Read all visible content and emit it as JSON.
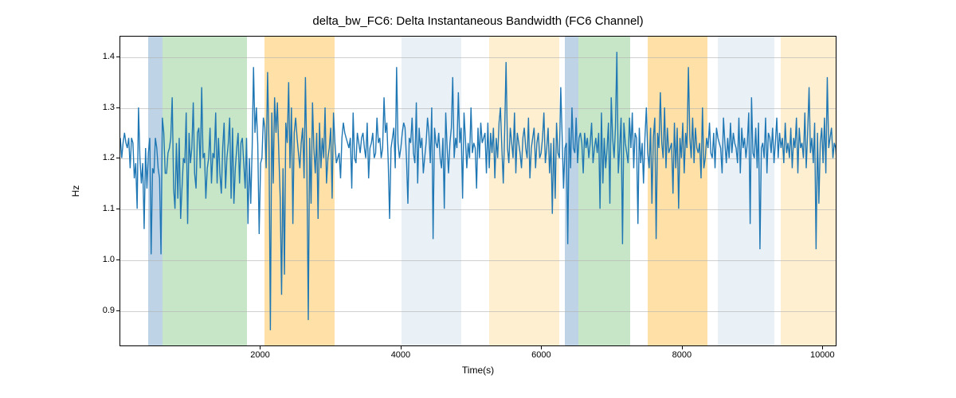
{
  "chart_data": {
    "type": "line",
    "title": "delta_bw_FC6: Delta Instantaneous Bandwidth (FC6 Channel)",
    "xlabel": "Time(s)",
    "ylabel": "Hz",
    "xlim": [
      0,
      10200
    ],
    "ylim": [
      0.83,
      1.44
    ],
    "x_ticks": [
      2000,
      4000,
      6000,
      8000,
      10000
    ],
    "y_ticks": [
      0.9,
      1.0,
      1.1,
      1.2,
      1.3,
      1.4
    ],
    "bands": [
      {
        "x0": 400,
        "x1": 600,
        "color": "blue-dark"
      },
      {
        "x0": 600,
        "x1": 1800,
        "color": "green"
      },
      {
        "x0": 2050,
        "x1": 3050,
        "color": "orange"
      },
      {
        "x0": 4000,
        "x1": 4200,
        "color": "blue-light"
      },
      {
        "x0": 4200,
        "x1": 4850,
        "color": "blue-light"
      },
      {
        "x0": 5250,
        "x1": 6250,
        "color": "orange-light"
      },
      {
        "x0": 6320,
        "x1": 6520,
        "color": "blue-dark"
      },
      {
        "x0": 6520,
        "x1": 7250,
        "color": "green"
      },
      {
        "x0": 7500,
        "x1": 8350,
        "color": "orange"
      },
      {
        "x0": 8500,
        "x1": 9300,
        "color": "blue-light"
      },
      {
        "x0": 9400,
        "x1": 10200,
        "color": "orange-light"
      }
    ],
    "series": [
      {
        "name": "delta_bw_FC6",
        "color": "#1f77b4",
        "x_start": 0,
        "x_step": 20,
        "values": [
          1.24,
          1.2,
          1.23,
          1.25,
          1.23,
          1.22,
          1.24,
          1.18,
          1.24,
          1.23,
          1.16,
          1.19,
          1.1,
          1.3,
          1.2,
          1.15,
          1.19,
          1.06,
          1.22,
          1.14,
          1.21,
          1.24,
          1.01,
          1.18,
          1.17,
          1.24,
          1.22,
          1.18,
          1.16,
          1.01,
          1.28,
          1.25,
          1.17,
          1.17,
          1.21,
          1.22,
          1.24,
          1.32,
          1.14,
          1.1,
          1.23,
          1.12,
          1.24,
          1.08,
          1.14,
          1.2,
          1.19,
          1.29,
          1.07,
          1.25,
          1.19,
          1.22,
          1.31,
          1.17,
          1.14,
          1.25,
          1.26,
          1.18,
          1.34,
          1.2,
          1.21,
          1.12,
          1.18,
          1.2,
          1.26,
          1.15,
          1.21,
          1.2,
          1.29,
          1.15,
          1.24,
          1.17,
          1.13,
          1.22,
          1.27,
          1.14,
          1.2,
          1.23,
          1.28,
          1.12,
          1.26,
          1.11,
          1.18,
          1.22,
          1.25,
          1.15,
          1.23,
          1.24,
          1.19,
          1.14,
          1.24,
          1.07,
          1.2,
          1.11,
          1.22,
          1.38,
          1.25,
          1.3,
          1.23,
          1.05,
          1.19,
          1.2,
          1.28,
          1.26,
          1.18,
          1.37,
          1.22,
          0.86,
          1.29,
          1.15,
          1.32,
          1.25,
          1.31,
          1.21,
          1.12,
          0.93,
          1.18,
          0.97,
          1.27,
          1.23,
          1.35,
          1.18,
          1.3,
          1.07,
          1.25,
          1.28,
          1.24,
          1.21,
          1.18,
          1.23,
          1.26,
          1.16,
          1.36,
          1.19,
          0.88,
          1.24,
          1.11,
          1.31,
          1.22,
          1.17,
          1.25,
          1.08,
          1.27,
          1.18,
          1.24,
          1.2,
          1.3,
          1.15,
          1.2,
          1.22,
          1.26,
          1.12,
          1.29,
          1.23,
          1.19,
          1.2,
          1.21,
          1.16,
          1.24,
          1.27,
          1.25,
          1.24,
          1.23,
          1.22,
          1.24,
          1.14,
          1.29,
          1.2,
          1.19,
          1.25,
          1.23,
          1.21,
          1.24,
          1.25,
          1.22,
          1.2,
          1.27,
          1.16,
          1.22,
          1.23,
          1.25,
          1.2,
          1.21,
          1.28,
          1.23,
          1.24,
          1.2,
          1.22,
          1.32,
          1.25,
          1.27,
          1.19,
          1.08,
          1.22,
          1.24,
          1.26,
          1.18,
          1.38,
          1.23,
          1.2,
          1.22,
          1.25,
          1.27,
          1.26,
          1.2,
          1.11,
          1.24,
          1.23,
          1.28,
          1.21,
          1.19,
          1.31,
          1.15,
          1.26,
          1.22,
          1.24,
          1.17,
          1.2,
          1.23,
          1.28,
          1.25,
          1.19,
          1.3,
          1.04,
          1.26,
          1.23,
          1.22,
          1.25,
          1.2,
          1.18,
          1.24,
          1.1,
          1.29,
          1.22,
          1.17,
          1.23,
          1.26,
          1.36,
          1.2,
          1.24,
          1.22,
          1.33,
          1.23,
          1.26,
          1.12,
          1.29,
          1.24,
          1.18,
          1.23,
          1.2,
          1.3,
          1.21,
          1.23,
          1.22,
          1.14,
          1.26,
          1.2,
          1.27,
          1.23,
          1.24,
          1.25,
          1.17,
          1.27,
          1.18,
          1.25,
          1.21,
          1.26,
          1.16,
          1.24,
          1.2,
          1.27,
          1.3,
          1.22,
          1.15,
          1.25,
          1.39,
          1.22,
          1.19,
          1.26,
          1.23,
          1.2,
          1.29,
          1.17,
          1.25,
          1.23,
          1.21,
          1.18,
          1.24,
          1.26,
          1.22,
          1.2,
          1.28,
          1.16,
          1.22,
          1.24,
          1.26,
          1.18,
          1.23,
          1.25,
          1.2,
          1.21,
          1.24,
          1.29,
          1.19,
          1.22,
          1.26,
          1.17,
          1.23,
          1.09,
          1.24,
          1.12,
          1.27,
          1.21,
          1.2,
          1.34,
          1.24,
          1.14,
          1.22,
          1.23,
          1.03,
          1.26,
          1.18,
          1.3,
          1.22,
          1.21,
          1.28,
          1.19,
          1.24,
          1.25,
          1.23,
          1.17,
          1.25,
          1.22,
          1.24,
          1.2,
          1.23,
          1.27,
          1.19,
          1.22,
          1.24,
          1.21,
          1.25,
          1.1,
          1.29,
          1.15,
          1.24,
          1.18,
          1.22,
          1.27,
          1.11,
          1.32,
          1.24,
          1.2,
          1.26,
          1.41,
          1.17,
          1.22,
          1.28,
          1.03,
          1.27,
          1.23,
          1.21,
          1.19,
          1.28,
          1.22,
          1.29,
          1.18,
          1.25,
          1.24,
          1.07,
          1.26,
          1.19,
          1.23,
          1.15,
          1.24,
          1.3,
          1.21,
          1.18,
          1.26,
          1.11,
          1.24,
          1.28,
          1.04,
          1.25,
          1.22,
          1.33,
          1.23,
          1.2,
          1.3,
          1.18,
          1.26,
          1.21,
          1.22,
          1.23,
          1.13,
          1.27,
          1.18,
          1.26,
          1.1,
          1.24,
          1.2,
          1.27,
          1.17,
          1.25,
          1.22,
          1.38,
          1.24,
          1.2,
          1.28,
          1.19,
          1.26,
          1.22,
          1.21,
          1.23,
          1.16,
          1.3,
          1.18,
          1.2,
          1.24,
          1.22,
          1.27,
          1.21,
          1.2,
          1.25,
          1.18,
          1.26,
          1.24,
          1.23,
          1.22,
          1.17,
          1.28,
          1.23,
          1.19,
          1.24,
          1.2,
          1.27,
          1.21,
          1.25,
          1.23,
          1.22,
          1.19,
          1.28,
          1.17,
          1.26,
          1.22,
          1.24,
          1.2,
          1.23,
          1.29,
          1.07,
          1.32,
          1.21,
          1.2,
          1.26,
          1.18,
          1.27,
          1.02,
          1.22,
          1.23,
          1.2,
          1.28,
          1.17,
          1.25,
          1.24,
          1.21,
          1.26,
          1.19,
          1.23,
          1.28,
          1.2,
          1.25,
          1.22,
          1.24,
          1.19,
          1.27,
          1.21,
          1.23,
          1.2,
          1.26,
          1.18,
          1.24,
          1.22,
          1.28,
          1.17,
          1.26,
          1.22,
          1.23,
          1.2,
          1.29,
          1.18,
          1.25,
          1.34,
          1.21,
          1.24,
          1.19,
          1.27,
          1.02,
          1.25,
          1.11,
          1.23,
          1.26,
          1.19,
          1.28,
          1.17,
          1.36,
          1.22,
          1.24,
          1.26,
          1.2,
          1.23,
          1.22,
          1.18,
          1.29,
          1.21,
          1.24,
          1.2,
          1.26,
          1.18,
          1.13,
          1.22
        ]
      }
    ]
  }
}
